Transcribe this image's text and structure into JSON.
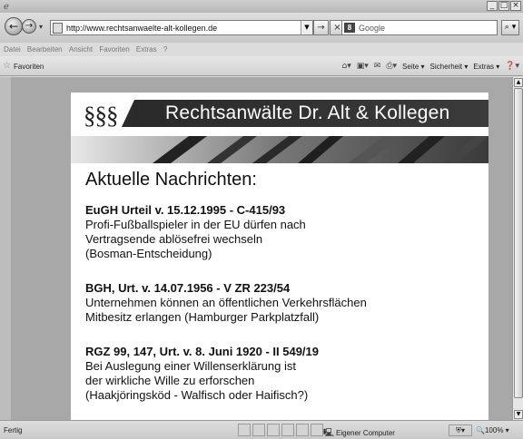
{
  "browser": {
    "address": "http://www.rechtsanwaelte-alt-kollegen.de",
    "search_placeholder": "Google",
    "menu": [
      "Datei",
      "Bearbeiten",
      "Ansicht",
      "Favoriten",
      "Extras",
      "?"
    ],
    "favorites_label": "Favoriten",
    "commands": {
      "page": "Seite",
      "safety": "Sicherheit",
      "tools": "Extras"
    },
    "status": {
      "text": "Fertig",
      "zone": "Eigener Computer",
      "zoom": "100%"
    }
  },
  "site": {
    "logo": "§§§",
    "title": "Rechtsanwälte Dr. Alt & Kollegen",
    "news_heading": "Aktuelle Nachrichten:",
    "items": [
      {
        "title": "EuGH Urteil v. 15.12.1995 - C-415/93",
        "lines": [
          "Profi-Fußballspieler in der EU dürfen nach",
          "Vertragsende ablösefrei wechseln",
          "(Bosman-Entscheidung)"
        ]
      },
      {
        "title": "BGH, Urt. v. 14.07.1956 - V ZR 223/54",
        "lines": [
          "Unternehmen können an öffentlichen Verkehrsflächen",
          "Mitbesitz erlangen (Hamburger Parkplatzfall)"
        ]
      },
      {
        "title": "RGZ 99, 147, Urt. v. 8. Juni 1920 - II 549/19",
        "lines": [
          "Bei Auslegung einer Willenserklärung ist",
          "der wirkliche Wille zu erforschen",
          "(Haakjöringsköd - Walfisch oder Haifisch?)"
        ]
      }
    ]
  }
}
